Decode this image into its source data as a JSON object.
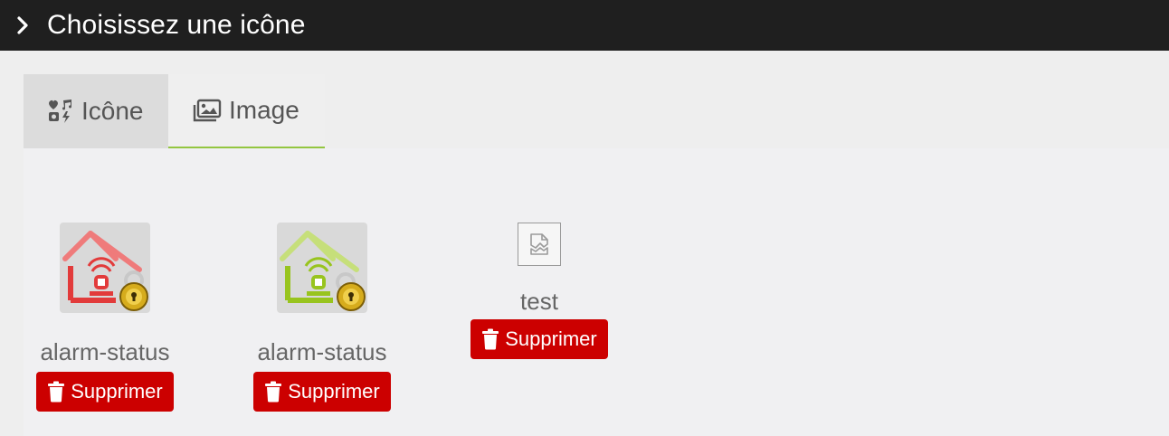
{
  "window": {
    "title": "Choisissez une icône"
  },
  "tabs": [
    {
      "label": "Icône",
      "icon": "icons-icon"
    },
    {
      "label": "Image",
      "icon": "images-icon"
    }
  ],
  "images": [
    {
      "name": "alarm-status",
      "delete_label": "Supprimer",
      "color": "#e23b3b"
    },
    {
      "name": "alarm-status",
      "delete_label": "Supprimer",
      "color": "#98c41e"
    },
    {
      "name": "test",
      "delete_label": "Supprimer",
      "broken": true
    }
  ],
  "colors": {
    "accent": "#93c640",
    "danger": "#cc0000",
    "titlebar": "#1f1f1f"
  }
}
